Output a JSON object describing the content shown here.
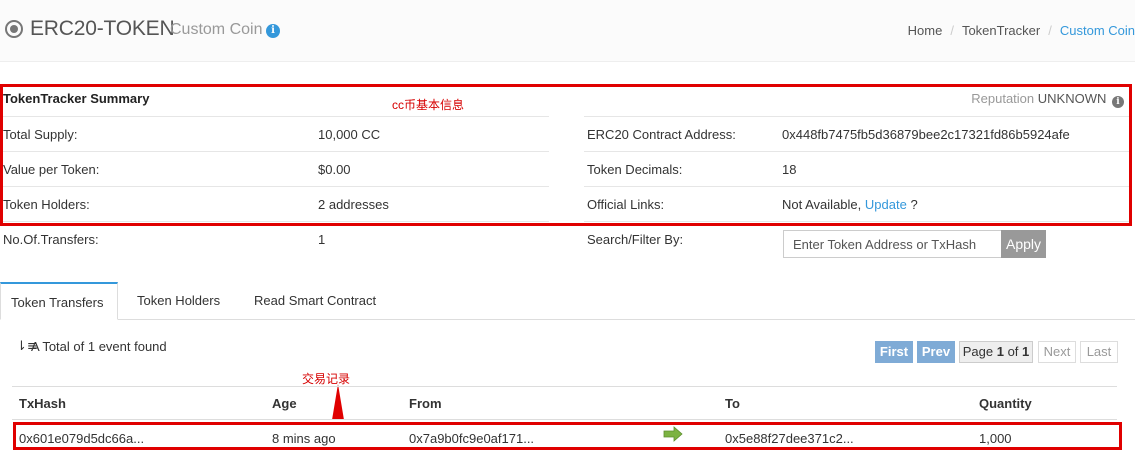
{
  "header": {
    "title": "ERC20-TOKEN",
    "subtitle": "Custom Coin",
    "info_glyph": "i",
    "breadcrumb": [
      "Home",
      "TokenTracker",
      "Custom Coin"
    ]
  },
  "summary": {
    "heading": "TokenTracker Summary",
    "reputation_label": "Reputation",
    "reputation_value": "UNKNOWN",
    "annotation": "cc币基本信息",
    "left_rows": [
      {
        "label": "Total Supply:",
        "value": "10,000 CC"
      },
      {
        "label": "Value per Token:",
        "value": "$0.00"
      },
      {
        "label": "Token Holders:",
        "value": "2 addresses"
      },
      {
        "label": "No.Of.Transfers:",
        "value": "1"
      }
    ],
    "right_rows": [
      {
        "label": "ERC20 Contract Address:",
        "value": "0x448fb7475fb5d36879bee2c17321fd86b5924afe"
      },
      {
        "label": "Token Decimals:",
        "value": "18"
      },
      {
        "label": "Official Links:",
        "value": "Not Available,",
        "link": "Update",
        "suffix": "?"
      },
      {
        "label": "Search/Filter By:"
      }
    ]
  },
  "search": {
    "placeholder": "Enter Token Address or TxHash",
    "button": "Apply"
  },
  "tabs": [
    {
      "label": "Token Transfers",
      "active": true
    },
    {
      "label": "Token Holders",
      "active": false
    },
    {
      "label": "Read Smart Contract",
      "active": false
    }
  ],
  "transfers": {
    "sort_icon": "sort-descending-icon",
    "total_text": "A Total of 1 event found",
    "annotation": "交易记录",
    "pager": {
      "first": "First",
      "prev": "Prev",
      "page_prefix": "Page",
      "page": "1",
      "of": "of",
      "total": "1",
      "next": "Next",
      "last": "Last"
    },
    "columns": [
      "TxHash",
      "Age",
      "From",
      "To",
      "Quantity"
    ],
    "rows": [
      {
        "txhash": "0x601e079d5dc66a...",
        "age": "8 mins ago",
        "from": "0x7a9b0fc9e0af171...",
        "to": "0x5e88f27dee371c2...",
        "quantity": "1,000"
      }
    ]
  },
  "colors": {
    "accent": "#3498db",
    "annotation_red": "#e00000",
    "pager_blue": "#7fabd6"
  }
}
